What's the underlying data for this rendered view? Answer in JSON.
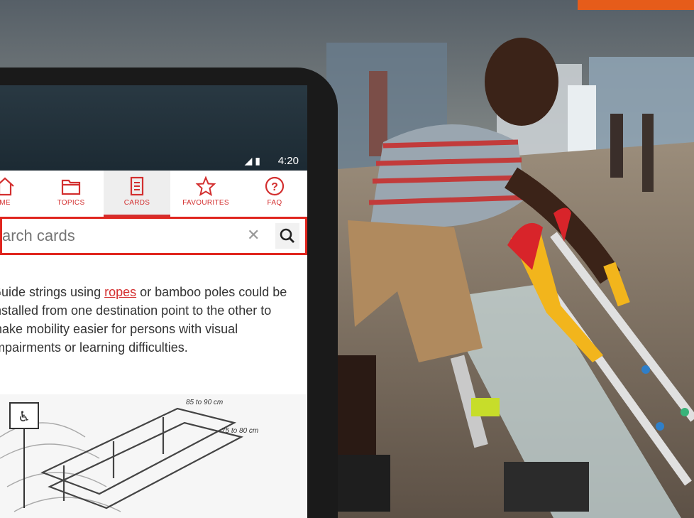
{
  "colors": {
    "accent": "#e65c1a",
    "brand_red": "#d32f2f",
    "search_border": "#e0261f"
  },
  "status_bar": {
    "time": "4:20"
  },
  "tabs": [
    {
      "label": "ME",
      "icon": "home-icon"
    },
    {
      "label": "TOPICS",
      "icon": "folder-icon"
    },
    {
      "label": "CARDS",
      "icon": "card-icon",
      "active": true
    },
    {
      "label": "FAVOURITES",
      "icon": "star-icon"
    },
    {
      "label": "FAQ",
      "icon": "question-icon"
    }
  ],
  "search": {
    "placeholder": "arch cards"
  },
  "card": {
    "text_before": "Guide strings using ",
    "link": "ropes",
    "text_after": " or bamboo poles could be installed from one destination point to the other to make mobility easier for persons with visual impairments or learning difficulties."
  },
  "diagram": {
    "dim_top": "85 to 90 cm",
    "dim_side": "75 to 80 cm"
  }
}
